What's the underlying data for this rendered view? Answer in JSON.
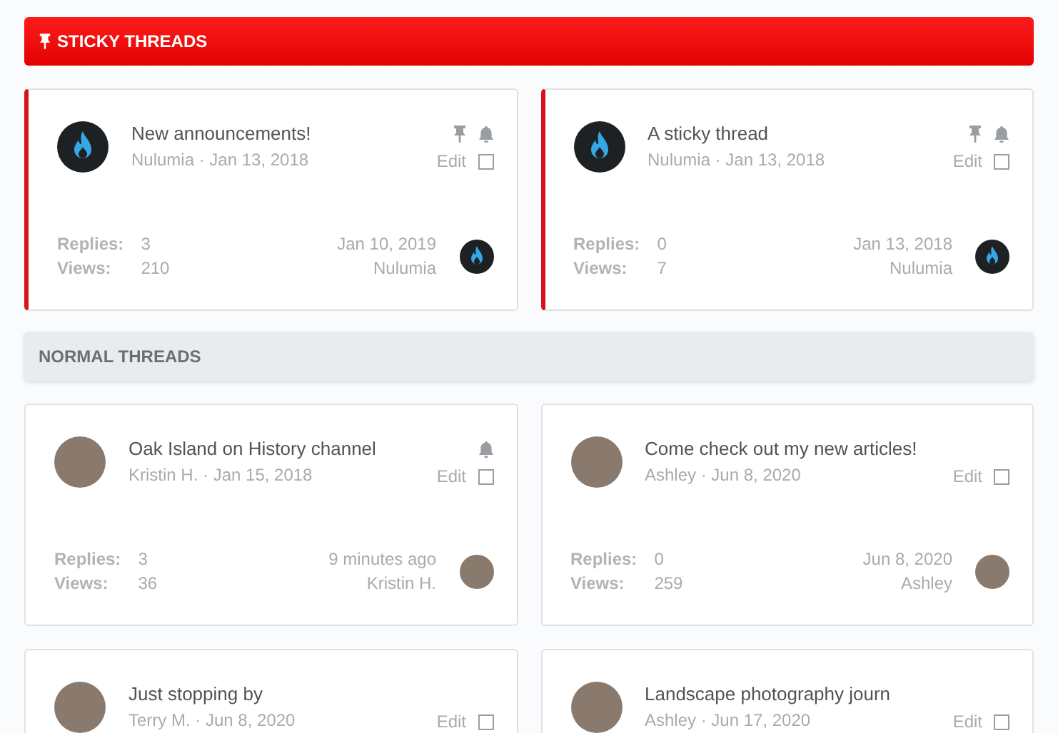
{
  "sections": [
    {
      "title": "STICKY THREADS",
      "kind": "sticky",
      "threads": [
        {
          "title": "New announcements!",
          "meta": "Nulumia · Jan 13, 2018",
          "avatar": {
            "kind": "logo"
          },
          "pinned": true,
          "watched": true,
          "edit": "Edit",
          "checked": false,
          "replies_label": "Replies:",
          "replies": "3",
          "views_label": "Views:",
          "views": "210",
          "last_date": "Jan 10, 2019",
          "last_user": "Nulumia",
          "last_avatar": {
            "kind": "logo"
          }
        },
        {
          "title": "A sticky thread",
          "meta": "Nulumia · Jan 13, 2018",
          "avatar": {
            "kind": "logo"
          },
          "pinned": true,
          "watched": true,
          "edit": "Edit",
          "checked": false,
          "replies_label": "Replies:",
          "replies": "0",
          "views_label": "Views:",
          "views": "7",
          "last_date": "Jan 13, 2018",
          "last_user": "Nulumia",
          "last_avatar": {
            "kind": "logo"
          }
        }
      ]
    },
    {
      "title": "NORMAL THREADS",
      "kind": "normal",
      "threads": [
        {
          "title": "Oak Island on History channel",
          "meta": "Kristin H. · Jan 15, 2018",
          "avatar": {
            "kind": "photo"
          },
          "pinned": false,
          "watched": true,
          "edit": "Edit",
          "checked": false,
          "replies_label": "Replies:",
          "replies": "3",
          "views_label": "Views:",
          "views": "36",
          "last_date": "9 minutes ago",
          "last_user": "Kristin H.",
          "last_avatar": {
            "kind": "photo"
          }
        },
        {
          "title": "Come check out my new articles!",
          "meta": "Ashley · Jun 8, 2020",
          "avatar": {
            "kind": "photo"
          },
          "pinned": false,
          "watched": false,
          "edit": "Edit",
          "checked": false,
          "replies_label": "Replies:",
          "replies": "0",
          "views_label": "Views:",
          "views": "259",
          "last_date": "Jun 8, 2020",
          "last_user": "Ashley",
          "last_avatar": {
            "kind": "photo"
          }
        },
        {
          "title": "Just stopping by",
          "meta": "Terry M. · Jun 8, 2020",
          "avatar": {
            "kind": "photo"
          },
          "pinned": false,
          "watched": false,
          "edit": "Edit",
          "checked": false
        },
        {
          "title": "Landscape photography journ",
          "meta": "Ashley · Jun 17, 2020",
          "avatar": {
            "kind": "photo"
          },
          "pinned": false,
          "watched": false,
          "edit": "Edit",
          "checked": false
        }
      ]
    }
  ]
}
